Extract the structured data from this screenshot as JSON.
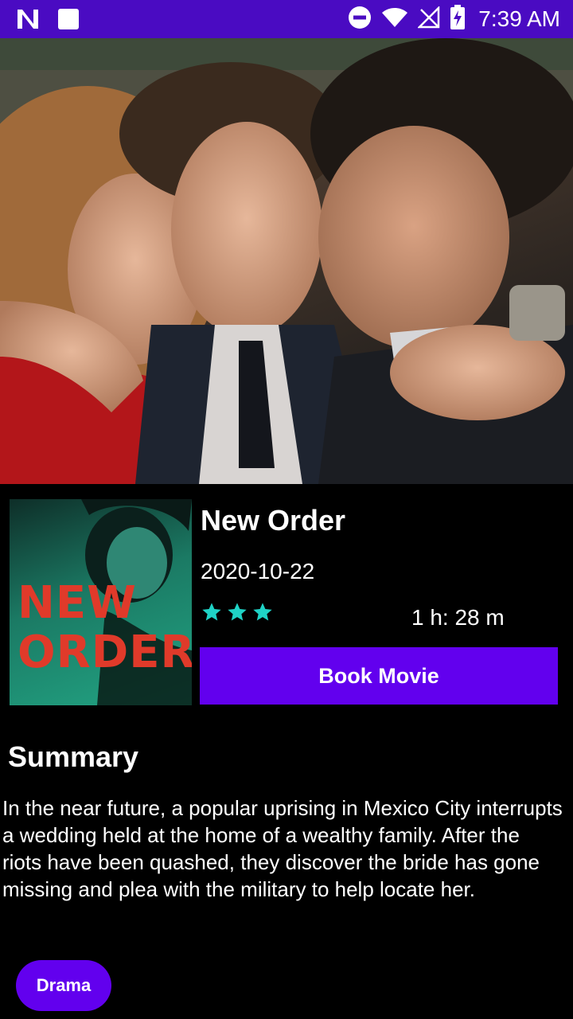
{
  "status_bar": {
    "time": "7:39 AM",
    "icons": [
      "n-logo-icon",
      "square-notification-icon",
      "do-not-disturb-icon",
      "wifi-icon",
      "no-signal-icon",
      "battery-charging-icon"
    ]
  },
  "movie": {
    "backdrop_icon": "backdrop-photo",
    "poster_title_line1": "NEW",
    "poster_title_line2": "ORDER",
    "title": "New Order",
    "release_date": "2020-10-22",
    "rating_stars": 3,
    "runtime": "1 h: 28 m",
    "book_button_label": "Book Movie"
  },
  "summary": {
    "heading": "Summary",
    "text": "In the near future, a popular uprising in Mexico City interrupts a wedding held at the home of a wealthy family. After the riots have been quashed, they discover the bride has gone missing and plea with the military to help locate her."
  },
  "genres": [
    "Drama"
  ],
  "colors": {
    "status_bar": "#4a0bc2",
    "accent": "#6200ee",
    "star": "#1fd3c6",
    "background": "#000000"
  }
}
